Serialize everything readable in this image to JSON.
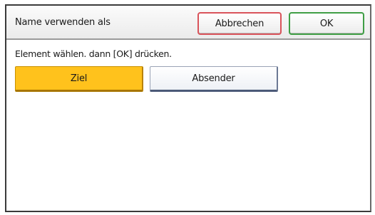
{
  "dialog": {
    "title": "Name verwenden als",
    "cancel_label": "Abbrechen",
    "ok_label": "OK",
    "instruction": "Element wählen. dann [OK] drücken."
  },
  "options": [
    {
      "label": "Ziel",
      "selected": true
    },
    {
      "label": "Absender",
      "selected": false
    }
  ],
  "colors": {
    "selected_option": "#ffc21c",
    "cancel_border": "#d9535a",
    "ok_border": "#3f9e45"
  }
}
